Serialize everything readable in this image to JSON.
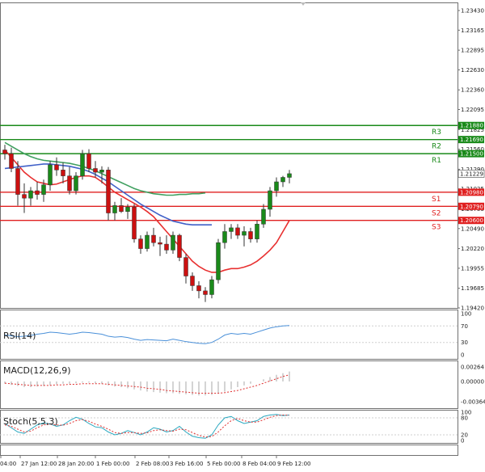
{
  "chart_data": [
    {
      "type": "candlestick",
      "panel": "price",
      "title": "",
      "y_axis": {
        "ticks": [
          "1.23430",
          "1.23165",
          "1.22895",
          "1.22630",
          "1.22360",
          "1.22095",
          "1.21825",
          "1.21560",
          "1.21290",
          "1.21025",
          "1.20755",
          "1.20490",
          "1.20220",
          "1.19955",
          "1.19685",
          "1.19420"
        ],
        "ylim": [
          1.1942,
          1.2343
        ]
      },
      "current_price": "1.21229",
      "levels": [
        {
          "label": "R3",
          "value": 1.2188,
          "value_label": "1.21880",
          "color": "#1a8a1a"
        },
        {
          "label": "R2",
          "value": 1.2169,
          "value_label": "1.21690",
          "color": "#1a8a1a"
        },
        {
          "label": "R1",
          "value": 1.215,
          "value_label": "1.21500",
          "color": "#1a8a1a"
        },
        {
          "label": "S1",
          "value": 1.2098,
          "value_label": "1.20980",
          "color": "#e02020"
        },
        {
          "label": "S2",
          "value": 1.2079,
          "value_label": "1.20790",
          "color": "#e02020"
        },
        {
          "label": "S3",
          "value": 1.206,
          "value_label": "1.20600",
          "color": "#e02020"
        }
      ],
      "moving_averages": [
        {
          "color": "#e83030",
          "values": [
            1.2155,
            1.2145,
            1.2135,
            1.2125,
            1.2118,
            1.2112,
            1.211,
            1.2108,
            1.2109,
            1.2112,
            1.2115,
            1.2118,
            1.212,
            1.212,
            1.2118,
            1.2112,
            1.2105,
            1.2098,
            1.2093,
            1.2088,
            1.2083,
            1.2078,
            1.2072,
            1.2065,
            1.2055,
            1.2045,
            1.2035,
            1.2025,
            1.2015,
            1.2005,
            1.1998,
            1.1993,
            1.199,
            1.199,
            1.1993,
            1.1995,
            1.1995,
            1.1997,
            1.2,
            1.2005,
            1.2012,
            1.202,
            1.203,
            1.2045,
            1.206
          ]
        },
        {
          "color": "#4060c8",
          "values": [
            1.213,
            1.2131,
            1.2132,
            1.2133,
            1.2134,
            1.2135,
            1.2136,
            1.2136,
            1.2135,
            1.2134,
            1.2133,
            1.2131,
            1.2129,
            1.2126,
            1.2122,
            1.2117,
            1.2112,
            1.2106,
            1.21,
            1.2094,
            1.2088,
            1.2082,
            1.2077,
            1.2072,
            1.2067,
            1.2063,
            1.2059,
            1.2057,
            1.2055,
            1.2054,
            1.2054,
            1.2054,
            1.2054
          ]
        },
        {
          "color": "#40a060",
          "values": [
            1.2165,
            1.216,
            1.2155,
            1.215,
            1.2146,
            1.2143,
            1.2141,
            1.214,
            1.2139,
            1.2138,
            1.2137,
            1.2135,
            1.2133,
            1.213,
            1.2127,
            1.2123,
            1.2119,
            1.2115,
            1.2111,
            1.2107,
            1.2103,
            1.21,
            1.2098,
            1.2096,
            1.2095,
            1.2094,
            1.2094,
            1.2095,
            1.2095,
            1.2096,
            1.2096,
            1.2097
          ]
        }
      ],
      "candles": [
        {
          "o": 1.2155,
          "h": 1.2162,
          "l": 1.2142,
          "c": 1.215
        },
        {
          "o": 1.215,
          "h": 1.2158,
          "l": 1.2125,
          "c": 1.213
        },
        {
          "o": 1.213,
          "h": 1.214,
          "l": 1.208,
          "c": 1.2095
        },
        {
          "o": 1.2095,
          "h": 1.211,
          "l": 1.207,
          "c": 1.209
        },
        {
          "o": 1.209,
          "h": 1.2105,
          "l": 1.208,
          "c": 1.21
        },
        {
          "o": 1.21,
          "h": 1.2112,
          "l": 1.2088,
          "c": 1.2095
        },
        {
          "o": 1.2095,
          "h": 1.2115,
          "l": 1.2085,
          "c": 1.2108
        },
        {
          "o": 1.2108,
          "h": 1.214,
          "l": 1.21,
          "c": 1.2135
        },
        {
          "o": 1.2135,
          "h": 1.2145,
          "l": 1.212,
          "c": 1.2128
        },
        {
          "o": 1.2128,
          "h": 1.2138,
          "l": 1.211,
          "c": 1.212
        },
        {
          "o": 1.212,
          "h": 1.2132,
          "l": 1.2095,
          "c": 1.21
        },
        {
          "o": 1.21,
          "h": 1.2125,
          "l": 1.2095,
          "c": 1.212
        },
        {
          "o": 1.212,
          "h": 1.2155,
          "l": 1.2115,
          "c": 1.215
        },
        {
          "o": 1.215,
          "h": 1.2156,
          "l": 1.2125,
          "c": 1.213
        },
        {
          "o": 1.213,
          "h": 1.214,
          "l": 1.2118,
          "c": 1.2125
        },
        {
          "o": 1.2125,
          "h": 1.2133,
          "l": 1.211,
          "c": 1.2128
        },
        {
          "o": 1.2128,
          "h": 1.2132,
          "l": 1.206,
          "c": 1.207
        },
        {
          "o": 1.207,
          "h": 1.2085,
          "l": 1.206,
          "c": 1.208
        },
        {
          "o": 1.208,
          "h": 1.209,
          "l": 1.207,
          "c": 1.2072
        },
        {
          "o": 1.2072,
          "h": 1.2082,
          "l": 1.2062,
          "c": 1.2078
        },
        {
          "o": 1.2078,
          "h": 1.2082,
          "l": 1.203,
          "c": 1.2035
        },
        {
          "o": 1.2035,
          "h": 1.204,
          "l": 1.2015,
          "c": 1.2022
        },
        {
          "o": 1.2022,
          "h": 1.2045,
          "l": 1.2018,
          "c": 1.204
        },
        {
          "o": 1.204,
          "h": 1.205,
          "l": 1.2025,
          "c": 1.203
        },
        {
          "o": 1.203,
          "h": 1.2038,
          "l": 1.2012,
          "c": 1.2028
        },
        {
          "o": 1.2028,
          "h": 1.204,
          "l": 1.2015,
          "c": 1.202
        },
        {
          "o": 1.202,
          "h": 1.2045,
          "l": 1.2015,
          "c": 1.204
        },
        {
          "o": 1.204,
          "h": 1.2042,
          "l": 1.2005,
          "c": 1.201
        },
        {
          "o": 1.201,
          "h": 1.2015,
          "l": 1.1975,
          "c": 1.1985
        },
        {
          "o": 1.1985,
          "h": 1.199,
          "l": 1.1965,
          "c": 1.1972
        },
        {
          "o": 1.1972,
          "h": 1.1978,
          "l": 1.1955,
          "c": 1.1965
        },
        {
          "o": 1.1965,
          "h": 1.197,
          "l": 1.195,
          "c": 1.196
        },
        {
          "o": 1.196,
          "h": 1.1985,
          "l": 1.1955,
          "c": 1.198
        },
        {
          "o": 1.198,
          "h": 1.2035,
          "l": 1.1975,
          "c": 1.203
        },
        {
          "o": 1.203,
          "h": 1.2055,
          "l": 1.2022,
          "c": 1.2045
        },
        {
          "o": 1.2045,
          "h": 1.2055,
          "l": 1.2035,
          "c": 1.205
        },
        {
          "o": 1.205,
          "h": 1.2055,
          "l": 1.2035,
          "c": 1.204
        },
        {
          "o": 1.204,
          "h": 1.2052,
          "l": 1.2025,
          "c": 1.2045
        },
        {
          "o": 1.2045,
          "h": 1.205,
          "l": 1.203,
          "c": 1.2035
        },
        {
          "o": 1.2035,
          "h": 1.206,
          "l": 1.203,
          "c": 1.2055
        },
        {
          "o": 1.2055,
          "h": 1.2082,
          "l": 1.205,
          "c": 1.2075
        },
        {
          "o": 1.2075,
          "h": 1.2105,
          "l": 1.2065,
          "c": 1.21
        },
        {
          "o": 1.21,
          "h": 1.2118,
          "l": 1.2092,
          "c": 1.2112
        },
        {
          "o": 1.2112,
          "h": 1.212,
          "l": 1.2105,
          "c": 1.2118
        },
        {
          "o": 1.2118,
          "h": 1.2128,
          "l": 1.211,
          "c": 1.2123
        }
      ]
    },
    {
      "type": "line",
      "panel": "rsi",
      "label": "RSI(14)",
      "y_ticks": [
        "100",
        "70",
        "30",
        "0"
      ],
      "ylim": [
        0,
        100
      ],
      "color": "#4a90d9",
      "values": [
        48,
        46,
        44,
        45,
        47,
        50,
        52,
        55,
        54,
        52,
        50,
        52,
        55,
        54,
        52,
        50,
        45,
        43,
        44,
        42,
        38,
        35,
        37,
        36,
        35,
        34,
        38,
        35,
        32,
        30,
        28,
        27,
        30,
        38,
        48,
        52,
        50,
        52,
        50,
        55,
        60,
        65,
        68,
        70,
        71
      ]
    },
    {
      "type": "bar",
      "panel": "macd",
      "label": "MACD(12,26,9)",
      "y_ticks": [
        "0.00264",
        "0.00000",
        "-0.00364"
      ],
      "ylim": [
        -0.0042,
        0.0032
      ],
      "histogram": [
        -0.0004,
        -0.0006,
        -0.0008,
        -0.001,
        -0.001,
        -0.0009,
        -0.0008,
        -0.0007,
        -0.0005,
        -0.0004,
        -0.0004,
        -0.0003,
        -0.0002,
        -0.0002,
        -0.0003,
        -0.0004,
        -0.0007,
        -0.0009,
        -0.001,
        -0.0012,
        -0.0014,
        -0.0016,
        -0.0018,
        -0.0019,
        -0.002,
        -0.0021,
        -0.0021,
        -0.0022,
        -0.0023,
        -0.0024,
        -0.0025,
        -0.0025,
        -0.0024,
        -0.0022,
        -0.0018,
        -0.0014,
        -0.001,
        -0.0007,
        -0.0004,
        0.0,
        0.0004,
        0.0008,
        0.0012,
        0.0015,
        0.0018
      ],
      "signal": [
        -0.0003,
        -0.0004,
        -0.0005,
        -0.0006,
        -0.0007,
        -0.0007,
        -0.0007,
        -0.0007,
        -0.0006,
        -0.0006,
        -0.0005,
        -0.0005,
        -0.0004,
        -0.0004,
        -0.0004,
        -0.0004,
        -0.0005,
        -0.0006,
        -0.0007,
        -0.0008,
        -0.0009,
        -0.001,
        -0.0012,
        -0.0013,
        -0.0014,
        -0.0016,
        -0.0017,
        -0.0018,
        -0.0019,
        -0.002,
        -0.0021,
        -0.0021,
        -0.0021,
        -0.0021,
        -0.002,
        -0.0018,
        -0.0016,
        -0.0013,
        -0.001,
        -0.0007,
        -0.0003,
        0.0001,
        0.0005,
        0.0009,
        0.0012
      ]
    },
    {
      "type": "line",
      "panel": "stoch",
      "label": "Stoch(5,5,3)",
      "y_ticks": [
        "100",
        "80",
        "20",
        "0"
      ],
      "ylim": [
        0,
        100
      ],
      "main_color": "#2aa8c0",
      "signal_color": "#e03030",
      "main": [
        60,
        45,
        30,
        25,
        40,
        55,
        62,
        58,
        50,
        55,
        70,
        82,
        75,
        60,
        48,
        45,
        30,
        20,
        25,
        35,
        28,
        20,
        30,
        45,
        40,
        30,
        35,
        50,
        30,
        15,
        10,
        8,
        20,
        55,
        80,
        85,
        70,
        60,
        65,
        70,
        85,
        90,
        92,
        88,
        90
      ],
      "signal": [
        55,
        50,
        40,
        30,
        33,
        45,
        55,
        58,
        55,
        54,
        60,
        70,
        74,
        68,
        58,
        50,
        40,
        28,
        25,
        28,
        28,
        25,
        27,
        35,
        38,
        35,
        33,
        40,
        38,
        28,
        18,
        12,
        14,
        30,
        52,
        70,
        78,
        70,
        65,
        65,
        73,
        82,
        88,
        90,
        89
      ]
    }
  ],
  "time_axis": [
    "04:00",
    "27 Jan 12:00",
    "28 Jan 20:00",
    "1 Feb 00:00",
    "2 Feb 08:00",
    "3 Feb 16:00",
    "5 Feb 00:00",
    "8 Feb 04:00",
    "9 Feb 12:00"
  ],
  "colors": {
    "bull": "#1a8a1a",
    "bear": "#cc1010",
    "grid": "#d0d0d0",
    "frame": "#707070",
    "text": "#222222"
  }
}
